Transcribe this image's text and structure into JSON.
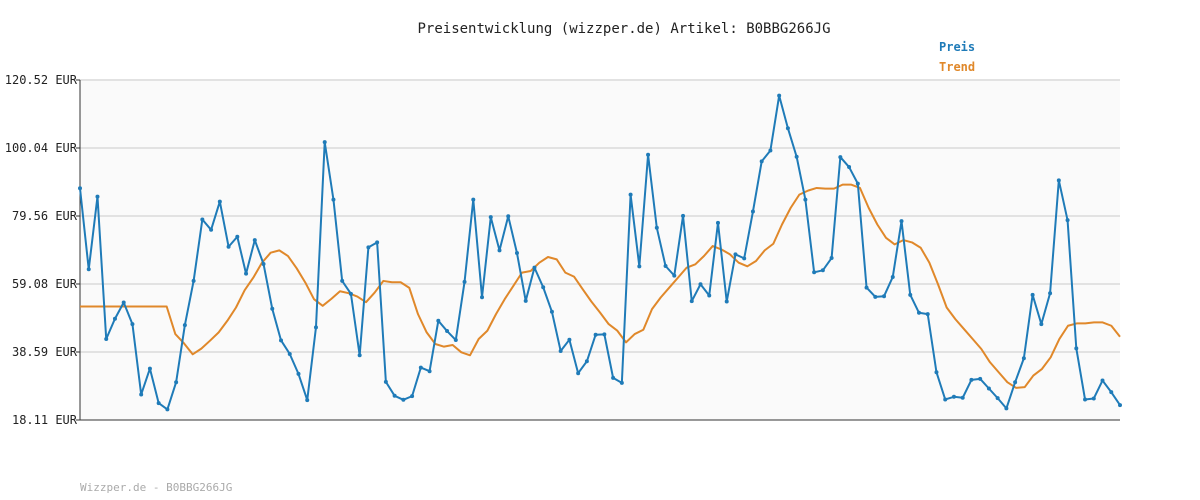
{
  "chart_data": {
    "type": "line",
    "title": "Preisentwicklung (wizzper.de) Artikel: B0BBG266JG",
    "xlabel": "",
    "ylabel": "",
    "y_ticks": [
      "18.11 EUR",
      "38.59 EUR",
      "59.08 EUR",
      "79.56 EUR",
      "100.04 EUR",
      "120.52 EUR"
    ],
    "y_tick_values": [
      18.11,
      38.59,
      59.08,
      79.56,
      100.04,
      120.52
    ],
    "ylim": [
      18.11,
      120.52
    ],
    "grid": true,
    "legend_position": "top-right",
    "series": [
      {
        "name": "Preis",
        "color": "#1f7bb8",
        "values": [
          87.9,
          63.5,
          85.4,
          42.5,
          48.6,
          53.5,
          47.0,
          25.8,
          33.6,
          23.2,
          21.3,
          29.5,
          46.7,
          60.0,
          78.5,
          75.4,
          83.9,
          70.3,
          73.3,
          62.2,
          72.3,
          65.1,
          51.6,
          42.1,
          38.0,
          32.0,
          24.1,
          46.0,
          101.8,
          84.5,
          60.0,
          56.1,
          37.6,
          70.1,
          71.6,
          29.6,
          25.4,
          24.2,
          25.3,
          33.9,
          32.8,
          48.0,
          44.9,
          42.2,
          59.7,
          84.5,
          55.1,
          79.2,
          69.2,
          79.5,
          68.4,
          54.0,
          64.0,
          58.1,
          50.7,
          38.9,
          42.3,
          32.2,
          35.8,
          43.8,
          43.9,
          30.8,
          29.3,
          86.0,
          64.4,
          98.0,
          76.0,
          64.5,
          61.6,
          79.6,
          53.9,
          59.0,
          55.6,
          77.5,
          53.8,
          68.0,
          66.8,
          80.9,
          96.0,
          99.3,
          115.8,
          106.0,
          97.4,
          84.5,
          62.6,
          63.2,
          66.9,
          97.3,
          94.3,
          89.3,
          58.0,
          55.2,
          55.4,
          61.2,
          78.0,
          55.8,
          50.4,
          50.0,
          32.5,
          24.3,
          25.1,
          24.8,
          30.2,
          30.5,
          27.6,
          24.7,
          21.6,
          29.5,
          36.7,
          55.8,
          47.0,
          56.3,
          90.3,
          78.3,
          39.7,
          24.3,
          24.6,
          30.0,
          26.5,
          22.6
        ]
      },
      {
        "name": "Trend",
        "color": "#e0882a",
        "values": [
          52.3,
          52.3,
          52.3,
          52.3,
          52.3,
          52.3,
          52.3,
          52.3,
          52.3,
          52.3,
          52.3,
          44.0,
          41.2,
          37.9,
          39.6,
          42.0,
          44.5,
          48.0,
          52.0,
          57.2,
          61.0,
          65.5,
          68.5,
          69.2,
          67.5,
          63.8,
          59.5,
          54.5,
          52.5,
          54.6,
          56.9,
          56.3,
          55.3,
          53.6,
          56.5,
          60.0,
          59.6,
          59.6,
          57.9,
          50.0,
          44.5,
          41.0,
          40.2,
          40.7,
          38.5,
          37.6,
          42.5,
          45.0,
          50.0,
          54.5,
          58.5,
          62.5,
          63.0,
          65.5,
          67.2,
          66.5,
          62.5,
          61.3,
          57.5,
          53.8,
          50.5,
          47.0,
          45.0,
          41.5,
          44.0,
          45.3,
          51.5,
          55.0,
          58.0,
          61.0,
          64.0,
          65.0,
          67.5,
          70.5,
          69.5,
          68.0,
          65.5,
          64.4,
          66.0,
          69.2,
          71.2,
          77.0,
          82.0,
          86.0,
          87.2,
          88.0,
          87.8,
          87.8,
          89.0,
          89.0,
          88.0,
          82.0,
          77.0,
          73.0,
          71.0,
          72.3,
          71.6,
          70.0,
          65.5,
          59.0,
          52.0,
          48.5,
          45.5,
          42.5,
          39.5,
          35.5,
          32.5,
          29.5,
          27.8,
          28.0,
          31.5,
          33.5,
          37.0,
          42.5,
          46.5,
          47.2,
          47.2,
          47.5,
          47.5,
          46.5,
          43.2
        ]
      }
    ]
  },
  "footer": {
    "text": "Wizzper.de - B0BBG266JG"
  }
}
